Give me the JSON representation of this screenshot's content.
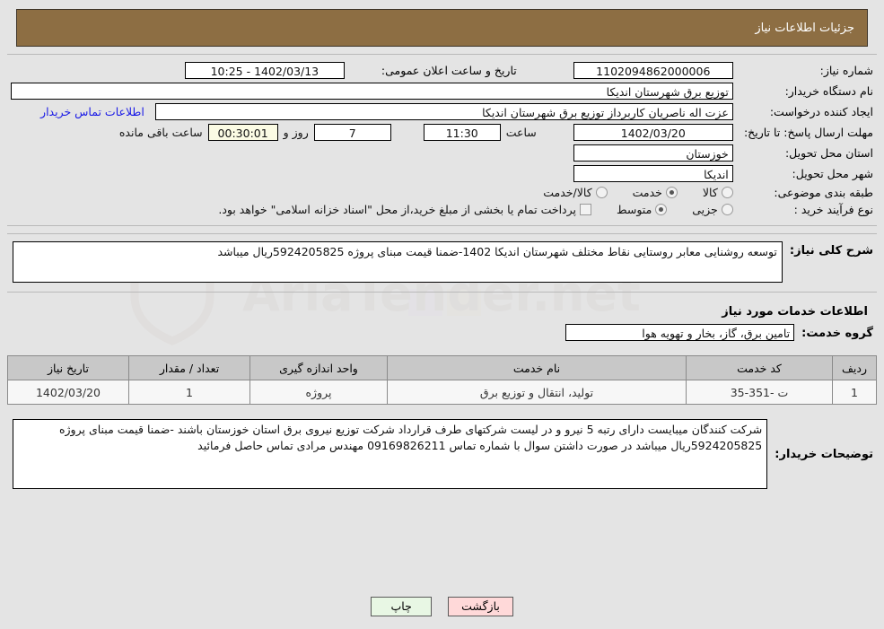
{
  "header": {
    "title": "جزئیات اطلاعات نیاز"
  },
  "form": {
    "need_number_label": "شماره نیاز:",
    "need_number_value": "1102094862000006",
    "public_announce_label": "تاریخ و ساعت اعلان عمومی:",
    "public_announce_value": "1402/03/13 - 10:25",
    "buyer_org_label": "نام دستگاه خریدار:",
    "buyer_org_value": "توزیع برق شهرستان اندیکا",
    "requester_label": "ایجاد کننده درخواست:",
    "requester_value": "عزت اله ناصریان کاربرداز توزیع برق شهرستان اندیکا",
    "buyer_contact_link": "اطلاعات تماس خریدار",
    "deadline_label": "مهلت ارسال پاسخ: تا تاریخ:",
    "deadline_date": "1402/03/20",
    "hour_label": "ساعت",
    "hour_value": "11:30",
    "days_value": "7",
    "days_label": "روز و",
    "countdown_value": "00:30:01",
    "countdown_label": "ساعت باقی مانده",
    "province_label": "استان محل تحویل:",
    "province_value": "خوزستان",
    "city_label": "شهر محل تحویل:",
    "city_value": "اندیکا",
    "category_label": "طبقه بندی موضوعی:",
    "category_options": [
      {
        "label": "کالا",
        "selected": false
      },
      {
        "label": "خدمت",
        "selected": true
      },
      {
        "label": "کالا/خدمت",
        "selected": false
      }
    ],
    "process_label": "نوع فرآیند خرید :",
    "process_options": [
      {
        "label": "جزیی",
        "selected": false
      },
      {
        "label": "متوسط",
        "selected": true
      }
    ],
    "treasury_checkbox_checked": false,
    "treasury_note": "پرداخت تمام یا بخشی از مبلغ خرید،از محل \"اسناد خزانه اسلامی\" خواهد بود."
  },
  "description": {
    "label": "شرح کلی نیاز:",
    "value": "توسعه روشنایی معابر روستایی نقاط مختلف شهرستان اندیکا 1402-ضمنا قیمت مبنای پروژه 5924205825ریال میباشد"
  },
  "services_section": {
    "heading": "اطلاعات خدمات مورد نیاز",
    "group_label": "گروه خدمت:",
    "group_value": "تامین برق، گاز، بخار و تهویه هوا"
  },
  "items_table": {
    "columns": [
      "ردیف",
      "کد خدمت",
      "نام خدمت",
      "واحد اندازه گیری",
      "تعداد / مقدار",
      "تاریخ نیاز"
    ],
    "rows": [
      {
        "row": "1",
        "code": "ت -351-35",
        "name": "تولید، انتقال و توزیع برق",
        "unit": "پروژه",
        "quantity": "1",
        "date": "1402/03/20"
      }
    ]
  },
  "comments": {
    "label": "توضیحات خریدار:",
    "value": "شرکت کنندگان میبایست دارای رتبه 5 نیرو و در لیست شرکتهای طرف قرارداد شرکت توزیع نیروی برق استان خوزستان باشند -ضمنا قیمت مبنای پروژه 5924205825ریال میباشد در صورت داشتن سوال با شماره تماس 09169826211 مهندس مرادی تماس حاصل فرمائید"
  },
  "buttons": {
    "back": "بازگشت",
    "print": "چاپ"
  },
  "watermark": {
    "text": "AriaTender.net"
  },
  "colors": {
    "header_brown": "#8d6e43",
    "page_background": "#e4e4e4",
    "link_blue": "#1a1ae6",
    "table_header_gray": "#c8c8c8",
    "back_button": "#ffd9d9",
    "print_button": "#e8f7e4",
    "countdown_ivory": "#fbfbe4"
  }
}
